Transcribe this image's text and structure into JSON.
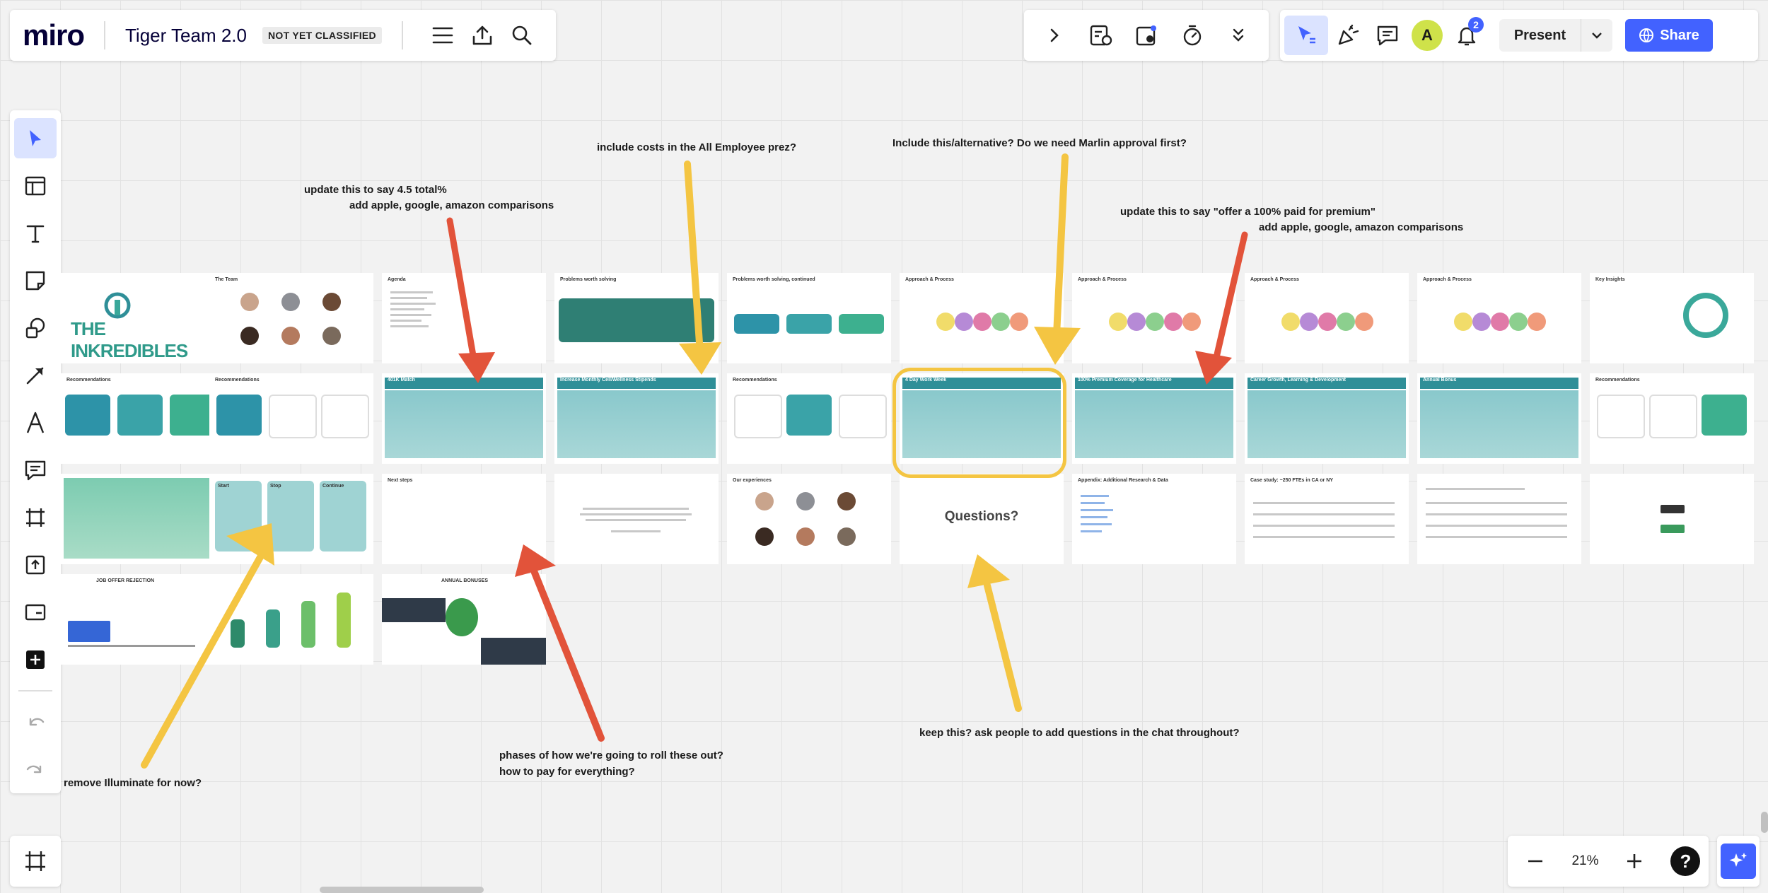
{
  "topbar": {
    "logo": "miro",
    "board_title": "Tiger Team 2.0",
    "classification": "NOT YET CLASSIFIED",
    "icons": [
      "menu-icon",
      "export-icon",
      "search-icon"
    ]
  },
  "tools": {
    "icons": [
      "chevron-right-icon",
      "timer-template-icon",
      "voting-icon",
      "stopwatch-icon",
      "chevron-double-down-icon"
    ]
  },
  "collab": {
    "avatar_initial": "A",
    "notifications": "2",
    "present_label": "Present",
    "share_label": "Share"
  },
  "left_toolbar": {
    "tools": [
      "select-tool",
      "templates-tool",
      "text-tool",
      "sticky-note-tool",
      "shapes-tool",
      "line-tool",
      "pen-tool",
      "comment-tool",
      "frame-tool",
      "upload-tool",
      "more-apps-tool",
      "add-tool"
    ],
    "history": [
      "undo",
      "redo"
    ]
  },
  "zoom": {
    "value": "21%",
    "help": "?"
  },
  "slides": {
    "r1c1_logo": "THE INKREDIBLES",
    "r1c2_title": "The Team",
    "r1c3_title": "Agenda",
    "r1c4_title": "Problems worth solving",
    "r1c5_title": "Problems worth solving, continued",
    "r1c6_title": "Approach & Process",
    "r1c7_title": "Approach & Process",
    "r1c8_title": "Approach & Process",
    "r1c9_title": "Approach & Process",
    "r1c10_title": "Key Insights",
    "r2c1_title": "Recommendations",
    "r2c2_title": "Recommendations",
    "r2c3_title": "401K Match",
    "r2c4_title": "Increase Monthly Cell/Wellness Stipends",
    "r2c5_title": "Recommendations",
    "r2c6_title": "4 Day Work Week",
    "r2c7_title": "100% Premium Coverage for Healthcare",
    "r2c8_title": "Career Growth, Learning & Development",
    "r2c9_title": "Annual Bonus",
    "r2c10_title": "Recommendations",
    "r3c2_labels": [
      "Start",
      "Stop",
      "Continue"
    ],
    "r3c3_title": "Next steps",
    "r3c6_text": "Questions?",
    "r3c5_title": "Our experiences",
    "r3c7_title": "Appendix: Additional Research & Data",
    "r3c8_title": "Case study: ~250 FTEs in CA or NY",
    "r4c1_title": "JOB OFFER REJECTION",
    "r4c3_title": "ANNUAL BONUSES"
  },
  "annotations": {
    "a1_line1": "update this to say 4.5 total%",
    "a1_line2": "add apple, google, amazon comparisons",
    "a2": "include costs in the All Employee prez?",
    "a3": "Include this/alternative? Do we need Marlin approval first?",
    "a4_line1": "update this to say \"offer a 100% paid for premium\"",
    "a4_line2": "add apple, google, amazon comparisons",
    "a5": "keep this? ask people to add questions in the chat throughout?",
    "a6_line1": "phases of how we're going to roll these out?",
    "a6_line2": "how to pay for everything?",
    "a7": "remove Illuminate for now?"
  },
  "colors": {
    "accent": "#4262ff",
    "arrow_yellow": "#f4c542",
    "arrow_red": "#e2533a",
    "teal": "#2f8f98"
  }
}
